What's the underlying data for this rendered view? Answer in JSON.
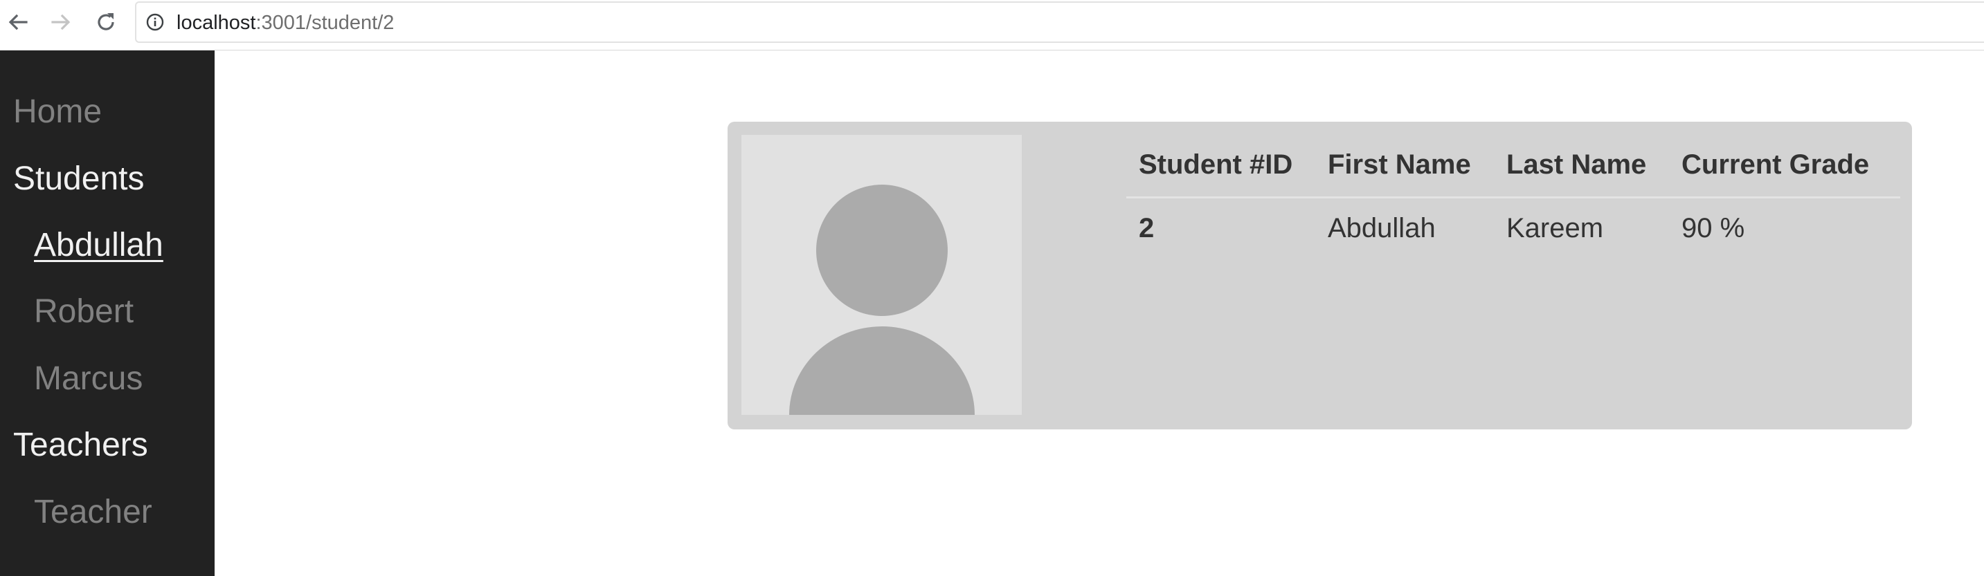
{
  "browser": {
    "url_host": "localhost",
    "url_rest": ":3001/student/2",
    "icons": {
      "back": "arrow-left-icon",
      "forward": "arrow-right-icon",
      "reload": "reload-icon",
      "info": "info-icon"
    }
  },
  "sidebar": {
    "items": [
      {
        "label": "Home",
        "style": "muted"
      },
      {
        "label": "Students",
        "style": "bright"
      },
      {
        "label": "Abdullah",
        "style": "active"
      },
      {
        "label": "Robert",
        "style": "muted"
      },
      {
        "label": "Marcus",
        "style": "muted"
      },
      {
        "label": "Teachers",
        "style": "bright"
      },
      {
        "label": "Teacher",
        "style": "muted"
      }
    ],
    "background_color": "#222222"
  },
  "student_card": {
    "avatar_icon": "person-placeholder-icon",
    "table": {
      "headers": [
        "Student #ID",
        "First Name",
        "Last Name",
        "Current Grade"
      ],
      "row": [
        "2",
        "Abdullah",
        "Kareem",
        "90 %"
      ]
    },
    "background_color": "#d3d3d3"
  }
}
